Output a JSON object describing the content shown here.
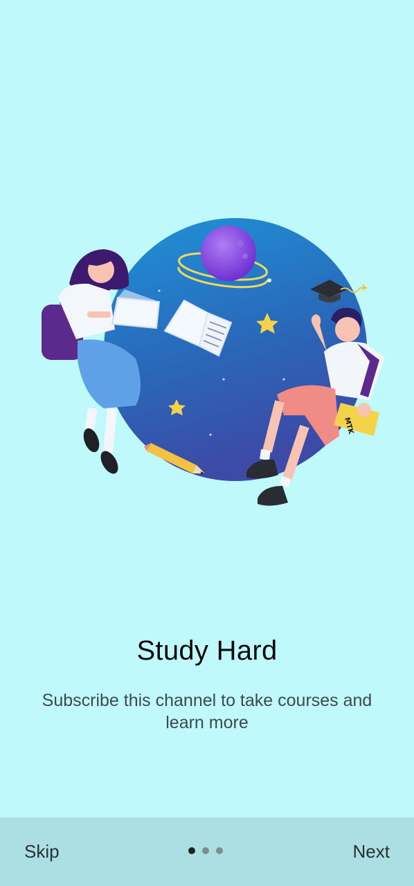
{
  "onboarding": {
    "title": "Study Hard",
    "subtitle": "Subscribe this channel to take courses and learn more",
    "illustration": {
      "book_label": "MTK",
      "icons": [
        "planet-icon",
        "graduation-cap-icon",
        "book-icon",
        "laptop-icon",
        "star-icon",
        "pencil-icon"
      ]
    }
  },
  "navigation": {
    "skip_label": "Skip",
    "next_label": "Next",
    "page_count": 3,
    "active_page": 1
  },
  "colors": {
    "background": "#bff9fb",
    "bottom_bar": "#acdfe4",
    "circle_top": "#1e8fd6",
    "circle_bottom": "#3b4fa9",
    "planet": "#8a3fe0"
  }
}
